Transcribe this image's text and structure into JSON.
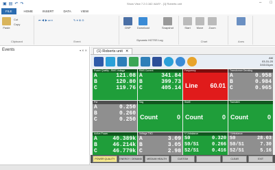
{
  "window": {
    "title": "Show View 7.2.0.162 /AAS* - [1] Roberts unit"
  },
  "ribbon": {
    "tabs": [
      "FILE",
      "HOME",
      "INSERT",
      "DATA",
      "VIEW"
    ],
    "clipboard": {
      "cut": "Cut",
      "copy": "Copy",
      "paste": "Paste",
      "label": "Clipboard"
    },
    "event_label": "Event",
    "dnp": {
      "label": "DNP",
      "items": [
        "Download",
        "Report Writer",
        "Snapshot"
      ]
    },
    "buttons": [
      "Start",
      "Stop",
      "Move",
      "Zoom"
    ],
    "chart_label": "Chart",
    "axes_label": "Axes",
    "footer": "Dynamic HOTSS Log"
  },
  "events_panel": {
    "title": "Events",
    "controls": "▾ ✕ ✕"
  },
  "doc": {
    "tab_label": "(1) Roberts unit",
    "clock": {
      "line1": "AM",
      "line2": "03-31-20",
      "line3": "3:53:31pm"
    }
  },
  "panels": [
    {
      "title": "Power Quality - RMS Voltage",
      "rows": [
        [
          "A",
          "121.08"
        ],
        [
          "B",
          "120.80"
        ],
        [
          "C",
          "119.76"
        ]
      ]
    },
    {
      "title": "RMS Current",
      "rows": [
        [
          "A",
          "341.84"
        ],
        [
          "B",
          "399.73"
        ],
        [
          "C",
          "405.14"
        ]
      ]
    },
    {
      "title": "Frequency",
      "center_label": "Line",
      "center_value": "60.01"
    },
    {
      "title": "Transformer Derating",
      "rows": [
        [
          "A",
          "0.958"
        ],
        [
          "B",
          "0.984"
        ],
        [
          "C",
          "0.965"
        ]
      ]
    },
    {
      "title": "Pst",
      "rows": [
        [
          "A",
          "0.250"
        ],
        [
          "B",
          "0.260"
        ],
        [
          "C",
          "0.250"
        ]
      ]
    },
    {
      "title": "Sag",
      "center_label": "Count",
      "center_value": "0"
    },
    {
      "title": "Swell",
      "center_label": "Count",
      "center_value": "0"
    },
    {
      "title": "Transient",
      "center_label": "Count",
      "center_value": "0"
    },
    {
      "title": "Active Power",
      "rows": [
        [
          "A",
          "40.389k"
        ],
        [
          "B",
          "46.214k"
        ],
        [
          "C",
          "46.779k"
        ]
      ]
    },
    {
      "title": "Voltage THD",
      "rows": [
        [
          "A",
          "3.09"
        ],
        [
          "B",
          "3.05"
        ],
        [
          "C",
          "2.98"
        ]
      ]
    },
    {
      "title": "V Unbalance",
      "rows": [
        [
          "S0",
          "0.320"
        ],
        [
          "S0/S1",
          "0.266"
        ],
        [
          "S2/S1",
          "0.416"
        ]
      ]
    },
    {
      "title": "I Unbalance",
      "rows": [
        [
          "S0",
          "28.03"
        ],
        [
          "S0/S1",
          "7.30"
        ],
        [
          "S2/S1",
          "5.16"
        ]
      ]
    }
  ],
  "bottom_buttons": [
    "POWER QUALITY",
    "ENERGY / DEMAND",
    "MEDIUM HEALTH",
    "CUSTOM",
    "",
    "CLEAR",
    "EXIT"
  ],
  "colors": {
    "green": "#1f9e3a",
    "gray": "#8f8f8f",
    "red": "#e01b1b",
    "blue_ui": "#2b6cb0"
  }
}
